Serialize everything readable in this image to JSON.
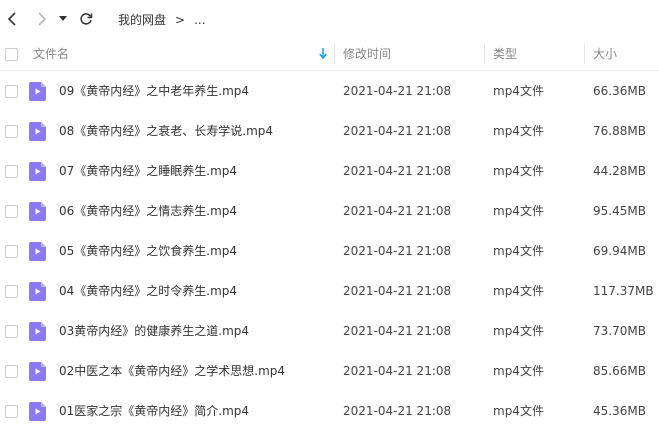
{
  "toolbar": {
    "breadcrumb": [
      "我的网盘",
      ">",
      "..."
    ]
  },
  "columns": {
    "name": "文件名",
    "modified": "修改时间",
    "type": "类型",
    "size": "大小"
  },
  "accent_color": "#8a7cf0",
  "files": [
    {
      "name": "09《黄帝内经》之中老年养生.mp4",
      "modified": "2021-04-21 21:08",
      "type": "mp4文件",
      "size": "66.36MB"
    },
    {
      "name": "08《黄帝内经》之衰老、长寿学说.mp4",
      "modified": "2021-04-21 21:08",
      "type": "mp4文件",
      "size": "76.88MB"
    },
    {
      "name": "07《黄帝内经》之睡眠养生.mp4",
      "modified": "2021-04-21 21:08",
      "type": "mp4文件",
      "size": "44.28MB"
    },
    {
      "name": "06《黄帝内经》之情志养生.mp4",
      "modified": "2021-04-21 21:08",
      "type": "mp4文件",
      "size": "95.45MB"
    },
    {
      "name": "05《黄帝内经》之饮食养生.mp4",
      "modified": "2021-04-21 21:08",
      "type": "mp4文件",
      "size": "69.94MB"
    },
    {
      "name": "04《黄帝内经》之时令养生.mp4",
      "modified": "2021-04-21 21:08",
      "type": "mp4文件",
      "size": "117.37MB"
    },
    {
      "name": "03黄帝内经》的健康养生之道.mp4",
      "modified": "2021-04-21 21:08",
      "type": "mp4文件",
      "size": "73.70MB"
    },
    {
      "name": "02中医之本《黄帝内经》之学术思想.mp4",
      "modified": "2021-04-21 21:08",
      "type": "mp4文件",
      "size": "85.66MB"
    },
    {
      "name": "01医家之宗《黄帝内经》简介.mp4",
      "modified": "2021-04-21 21:08",
      "type": "mp4文件",
      "size": "45.36MB"
    }
  ]
}
